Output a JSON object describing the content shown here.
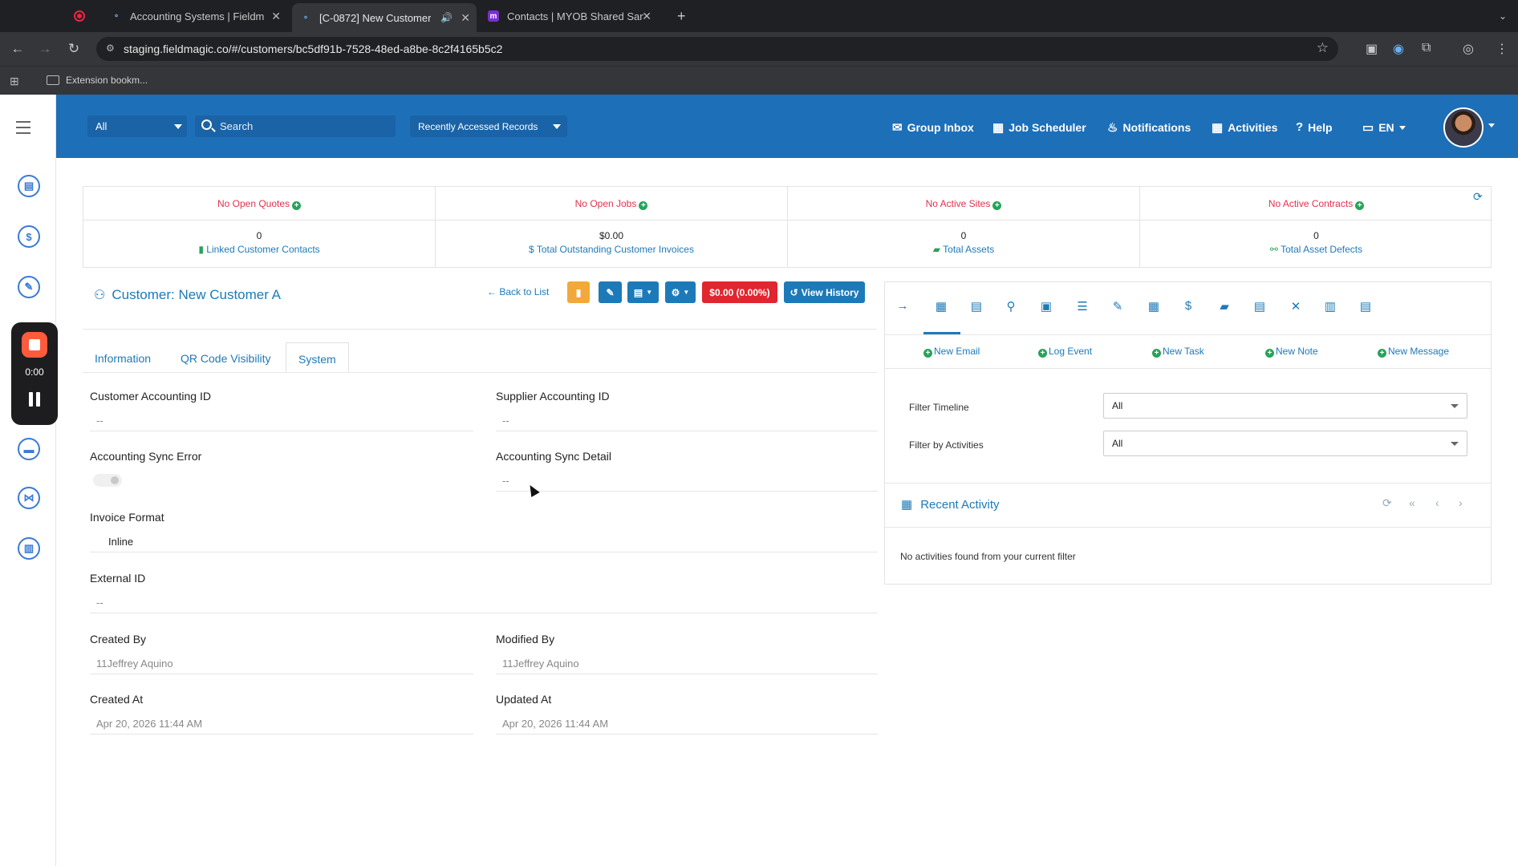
{
  "browser": {
    "tabs": [
      {
        "title": "Accounting Systems | Fieldm",
        "active": false
      },
      {
        "title": "[C-0872] New Customer",
        "active": true
      },
      {
        "title": "Contacts | MYOB Shared San",
        "active": false
      }
    ],
    "url": "staging.fieldmagic.co/#/customers/bc5df91b-7528-48ed-a8be-8c2f4165b5c2",
    "bookmark_label": "Extension bookm..."
  },
  "header": {
    "scope_select": "All",
    "search_placeholder": "Search",
    "recent_records": "Recently Accessed Records",
    "nav": {
      "group_inbox": "Group Inbox",
      "job_scheduler": "Job Scheduler",
      "notifications": "Notifications",
      "activities": "Activities",
      "help": "Help",
      "language": "EN"
    }
  },
  "recorder": {
    "time": "0:00"
  },
  "stats": [
    {
      "top": "No Open Quotes",
      "value": "0",
      "label": "Linked Customer Contacts"
    },
    {
      "top": "No Open Jobs",
      "value": "$0.00",
      "label": "Total Outstanding Customer Invoices"
    },
    {
      "top": "No Active Sites",
      "value": "0",
      "label": "Total Assets"
    },
    {
      "top": "No Active Contracts",
      "value": "0",
      "label": "Total Asset Defects"
    }
  ],
  "customer": {
    "title": "Customer: New Customer A",
    "back": "Back to List",
    "balance": "$0.00 (0.00%)",
    "view_history": "View History",
    "tabs": [
      "Information",
      "QR Code Visibility",
      "System"
    ],
    "fields": {
      "customer_accounting_id": {
        "label": "Customer Accounting ID",
        "value": "--"
      },
      "supplier_accounting_id": {
        "label": "Supplier Accounting ID",
        "value": "--"
      },
      "accounting_sync_error": {
        "label": "Accounting Sync Error"
      },
      "accounting_sync_detail": {
        "label": "Accounting Sync Detail",
        "value": "--"
      },
      "invoice_format": {
        "label": "Invoice Format",
        "value": "Inline"
      },
      "external_id": {
        "label": "External ID",
        "value": "--"
      },
      "created_by": {
        "label": "Created By",
        "value": "11Jeffrey Aquino"
      },
      "modified_by": {
        "label": "Modified By",
        "value": "11Jeffrey Aquino"
      },
      "created_at": {
        "label": "Created At",
        "value": "Apr 20, 2026 11:44 AM"
      },
      "updated_at": {
        "label": "Updated At",
        "value": "Apr 20, 2026 11:44 AM"
      }
    }
  },
  "timeline": {
    "actions": [
      "New Email",
      "Log Event",
      "New Task",
      "New Note",
      "New Message"
    ],
    "filter_timeline_label": "Filter Timeline",
    "filter_timeline_value": "All",
    "filter_activities_label": "Filter by Activities",
    "filter_activities_value": "All",
    "recent_activity_title": "Recent Activity",
    "empty_message": "No activities found from your current filter"
  },
  "colors": {
    "header_blue": "#1d6fb8",
    "link_blue": "#1d7ab8",
    "alert_red": "#e0334b",
    "add_green": "#27a35a",
    "delete_orange": "#f3a83b",
    "balance_red": "#e0262f"
  }
}
